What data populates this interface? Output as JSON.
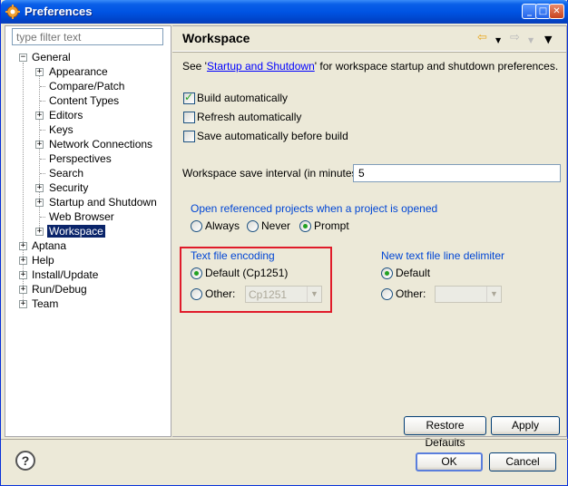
{
  "window": {
    "title": "Preferences"
  },
  "sidebar": {
    "filter_placeholder": "type filter text",
    "items": [
      {
        "label": "General",
        "level": 0,
        "expanded": true
      },
      {
        "label": "Appearance",
        "level": 1,
        "expandable": true
      },
      {
        "label": "Compare/Patch",
        "level": 1
      },
      {
        "label": "Content Types",
        "level": 1
      },
      {
        "label": "Editors",
        "level": 1,
        "expandable": true
      },
      {
        "label": "Keys",
        "level": 1
      },
      {
        "label": "Network Connections",
        "level": 1,
        "expandable": true
      },
      {
        "label": "Perspectives",
        "level": 1
      },
      {
        "label": "Search",
        "level": 1
      },
      {
        "label": "Security",
        "level": 1,
        "expandable": true
      },
      {
        "label": "Startup and Shutdown",
        "level": 1,
        "expandable": true
      },
      {
        "label": "Web Browser",
        "level": 1
      },
      {
        "label": "Workspace",
        "level": 1,
        "expandable": true,
        "selected": true
      },
      {
        "label": "Aptana",
        "level": 0,
        "expandable": true
      },
      {
        "label": "Help",
        "level": 0,
        "expandable": true
      },
      {
        "label": "Install/Update",
        "level": 0,
        "expandable": true
      },
      {
        "label": "Run/Debug",
        "level": 0,
        "expandable": true
      },
      {
        "label": "Team",
        "level": 0,
        "expandable": true
      }
    ]
  },
  "page": {
    "title": "Workspace",
    "intro_prefix": "See '",
    "intro_link": "Startup and Shutdown",
    "intro_suffix": "' for workspace startup and shutdown preferences.",
    "build_auto": "Build automatically",
    "refresh_auto": "Refresh automatically",
    "save_auto": "Save automatically before build",
    "save_interval_label": "Workspace save interval (in minutes):",
    "save_interval_value": "5",
    "open_ref_label": "Open referenced projects when a project is opened",
    "open_ref_always": "Always",
    "open_ref_never": "Never",
    "open_ref_prompt": "Prompt",
    "encoding_label": "Text file encoding",
    "encoding_default": "Default (Cp1251)",
    "encoding_other": "Other:",
    "encoding_other_value": "Cp1251",
    "delimiter_label": "New text file line delimiter",
    "delimiter_default": "Default",
    "delimiter_other": "Other:",
    "restore_defaults": "Restore Defaults",
    "apply": "Apply"
  },
  "footer": {
    "ok": "OK",
    "cancel": "Cancel",
    "help_glyph": "?"
  },
  "colors": {
    "titlebar": "#0054e3",
    "selection": "#0a246a",
    "group_label": "#0046d5",
    "highlight_box": "#e01b2a"
  }
}
